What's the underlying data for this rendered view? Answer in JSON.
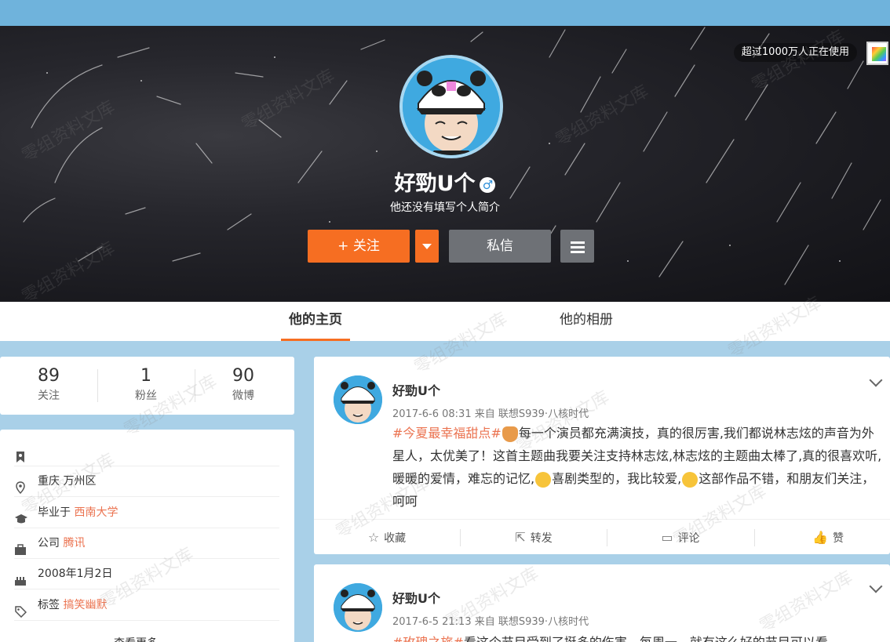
{
  "header": {
    "users_count_label": "超过1000万人正在使用"
  },
  "profile": {
    "name": "好勁U个",
    "gender_symbol": "♂",
    "bio": "他还没有填写个人简介",
    "follow_label": "关注",
    "follow_plus": "+",
    "message_label": "私信"
  },
  "tabs": [
    {
      "label": "他的主页",
      "active": true
    },
    {
      "label": "他的相册",
      "active": false
    }
  ],
  "stats": [
    {
      "value": "89",
      "label": "关注"
    },
    {
      "value": "1",
      "label": "粉丝"
    },
    {
      "value": "90",
      "label": "微博"
    }
  ],
  "info": {
    "location": "重庆 万州区",
    "school_prefix": "毕业于",
    "school": "西南大学",
    "company_prefix": "公司",
    "company": "腾讯",
    "birthday": "2008年1月2日",
    "tags_prefix": "标签",
    "tags": "搞笑幽默",
    "more": "查看更多"
  },
  "posts": [
    {
      "author": "好勁U个",
      "meta": "2017-6-6 08:31 来自 联想S939·八核时代",
      "topic": "#今夏最幸福甜点#",
      "text_1": "每一个演员都充满演技，真的很厉害,我们都说林志炫的声音为外星人，太优美了！这首主题曲我要关注支持林志炫,林志炫的主题曲太棒了,真的很喜欢听,暖暖的爱情，难忘的记忆,",
      "text_2": "喜剧类型的，我比较爱,",
      "text_3": "这部作品不错，和朋友们关注，呵呵",
      "actions": {
        "collect": "收藏",
        "repost": "转发",
        "comment": "评论",
        "like": "赞"
      }
    },
    {
      "author": "好勁U个",
      "meta": "2017-6-5 21:13 来自 联想S939·八核时代",
      "topic": "#玫瑰之旅#",
      "text_1": "看这个节目受到了挺多的伤害，每周一，就有这么好的节目可以看"
    }
  ],
  "watermark_text": "零组资料文库",
  "colors": {
    "accent": "#f66e22",
    "topic": "#eb7350",
    "gray_button": "#6e7176"
  }
}
